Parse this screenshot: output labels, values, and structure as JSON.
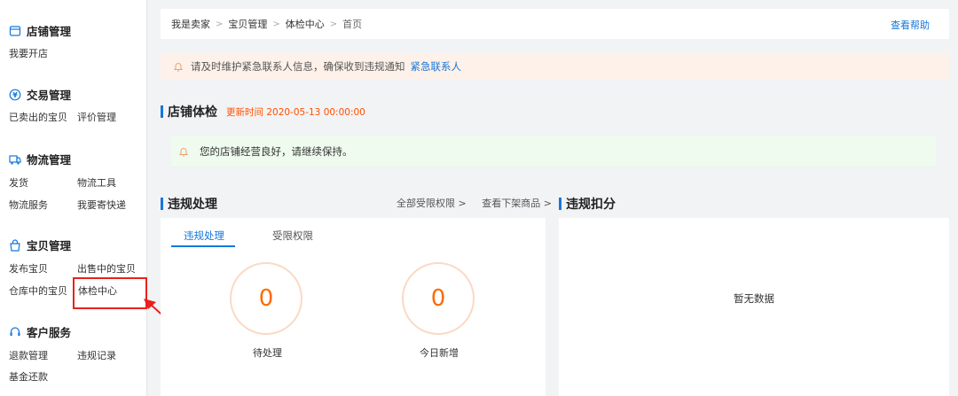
{
  "sidebar": {
    "shop": {
      "title": "店铺管理",
      "items": [
        "我要开店"
      ]
    },
    "trade": {
      "title": "交易管理",
      "items": [
        "已卖出的宝贝",
        "评价管理"
      ]
    },
    "logistics": {
      "title": "物流管理",
      "items": [
        "发货",
        "物流工具",
        "物流服务",
        "我要寄快递"
      ]
    },
    "goods": {
      "title": "宝贝管理",
      "items": [
        "发布宝贝",
        "出售中的宝贝",
        "仓库中的宝贝",
        "体检中心"
      ]
    },
    "service": {
      "title": "客户服务",
      "items": [
        "退款管理",
        "违规记录",
        "基金还款"
      ]
    }
  },
  "breadcrumb": [
    "我是卖家",
    "宝贝管理",
    "体检中心",
    "首页"
  ],
  "help_label": "查看帮助",
  "notice": {
    "text": "请及时维护紧急联系人信息，确保收到违规通知",
    "link": "紧急联系人"
  },
  "health": {
    "title": "店铺体检",
    "updated": "更新时间 2020-05-13 00:00:00",
    "message": "您的店铺经营良好，请继续保持。"
  },
  "violation": {
    "title": "违规处理",
    "links": [
      "全部受限权限 >",
      "查看下架商品 >"
    ],
    "tabs": [
      "违规处理",
      "受限权限"
    ],
    "stats": [
      {
        "value": "0",
        "label": "待处理"
      },
      {
        "value": "0",
        "label": "今日新增"
      }
    ]
  },
  "deduction": {
    "title": "违规扣分",
    "empty": "暂无数据"
  },
  "colors": {
    "accent": "#1677d9",
    "highlight": "#e8221c",
    "orange": "#ff6a00"
  }
}
